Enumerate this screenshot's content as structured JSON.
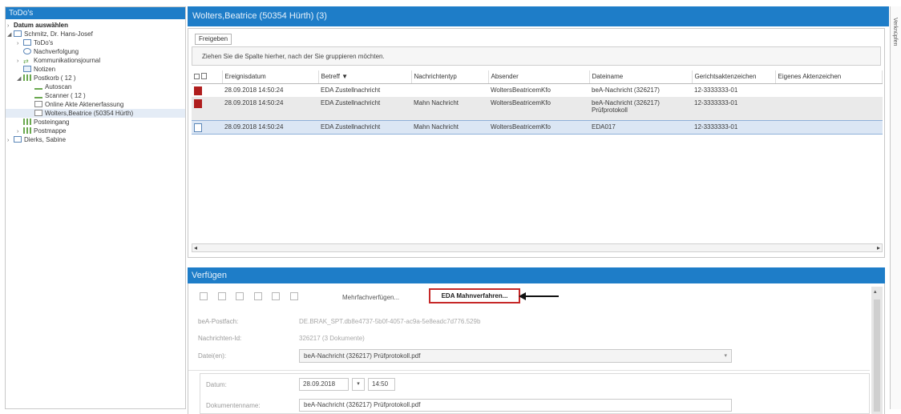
{
  "left_panel": {
    "title": "ToDo's",
    "tree": [
      {
        "label": "Datum auswählen"
      },
      {
        "label": "Schmitz, Dr. Hans-Josef"
      },
      {
        "label": "ToDo's"
      },
      {
        "label": "Nachverfolgung"
      },
      {
        "label": "Kommunikationsjournal"
      },
      {
        "label": "Notizen"
      },
      {
        "label": "Postkorb ( 12 )"
      },
      {
        "label": "Autoscan"
      },
      {
        "label": "Scanner ( 12 )"
      },
      {
        "label": "Online Akte Aktenerfassung"
      },
      {
        "label": "Wolters,Beatrice (50354 Hürth)"
      },
      {
        "label": "Posteingang"
      },
      {
        "label": "Postmappe"
      },
      {
        "label": "Dierks, Sabine"
      }
    ]
  },
  "main": {
    "title": "Wolters,Beatrice (50354 Hürth) (3)",
    "freigeben_label": "Freigeben",
    "group_hint": "Ziehen Sie die Spalte hierher, nach der Sie gruppieren möchten.",
    "columns": [
      "Ereignisdatum",
      "Betreff",
      "Nachrichtentyp",
      "Absender",
      "Dateiname",
      "Gerichtsaktenzeichen",
      "Eigenes Aktenzeichen"
    ],
    "rows": [
      {
        "icon": "pdf-icon",
        "datum": "28.09.2018 14:50:24",
        "betreff": "EDA Zustellnachricht",
        "typ": "",
        "absender": "WoltersBeatricemKfo",
        "dateiname": "beA-Nachricht (326217)",
        "dateiname2": "",
        "gericht": "12-3333333-01",
        "eigenes": ""
      },
      {
        "icon": "pdf-icon",
        "datum": "28.09.2018 14:50:24",
        "betreff": "EDA Zustellnachricht",
        "typ": "Mahn Nachricht",
        "absender": "WoltersBeatricemKfo",
        "dateiname": "beA-Nachricht (326217)",
        "dateiname2": "Prüfprotokoll",
        "gericht": "12-3333333-01",
        "eigenes": ""
      },
      {
        "icon": "doc-icon",
        "datum": "28.09.2018 14:50:24",
        "betreff": "EDA Zustellnachricht",
        "typ": "Mahn Nachricht",
        "absender": "WoltersBeatricemKfo",
        "dateiname": "EDA017",
        "dateiname2": "",
        "gericht": "12-3333333-01",
        "eigenes": ""
      }
    ]
  },
  "side_tab": "Verknüpfen",
  "verfuegen": {
    "title": "Verfügen",
    "mehrfach_label": "Mehrfachverfügen...",
    "eda_button_label": "EDA Mahnverfahren...",
    "fields": {
      "bea_postfach_label": "beA-Postfach:",
      "bea_postfach_value": "DE.BRAK_SPT.db8e4737-5b0f-4057-ac9a-5e8eadc7d776.529b",
      "nachrichten_id_label": "Nachrichten-Id:",
      "nachrichten_id_value": "326217 (3 Dokumente)",
      "dateien_label": "Datei(en):",
      "dateien_value": "beA-Nachricht (326217) Prüfprotokoll.pdf",
      "datum_label": "Datum:",
      "datum_value": "28.09.2018",
      "zeit_value": "14:50",
      "dokumentenname_label": "Dokumentenname:",
      "dokumentenname_value": "beA-Nachricht (326217) Prüfprotokoll.pdf"
    }
  },
  "colors": {
    "accent": "#1e7dc8",
    "highlight_border": "#c62828",
    "pdf_red": "#b01e1e"
  }
}
